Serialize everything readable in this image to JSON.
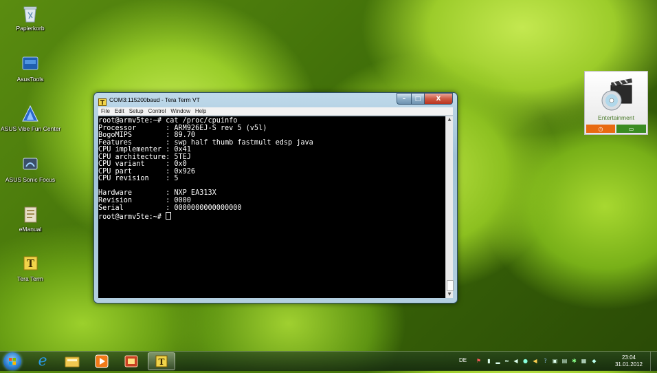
{
  "desktop": {
    "icons": [
      {
        "label": "Papierkorb",
        "icon": "recycle-bin-icon"
      },
      {
        "label": "AsusTools",
        "icon": "asus-tools-icon"
      },
      {
        "label": "ASUS Vibe Fun Center",
        "icon": "asus-vibe-icon"
      },
      {
        "label": "ASUS Sonic Focus",
        "icon": "asus-sonic-focus-icon"
      },
      {
        "label": "eManual",
        "icon": "emanual-icon"
      },
      {
        "label": "Tera Term",
        "icon": "tera-term-icon"
      }
    ]
  },
  "window": {
    "title": "COM3:115200baud - Tera Term VT",
    "minimize_glyph": "–",
    "maximize_glyph": "□",
    "close_glyph": "X",
    "menu": [
      "File",
      "Edit",
      "Setup",
      "Control",
      "Window",
      "Help"
    ]
  },
  "terminal": {
    "lines": [
      "root@armv5te:~# cat /proc/cpuinfo",
      "Processor       : ARM926EJ-S rev 5 (v5l)",
      "BogoMIPS        : 89.70",
      "Features        : swp half thumb fastmult edsp java",
      "CPU implementer : 0x41",
      "CPU architecture: 5TEJ",
      "CPU variant     : 0x0",
      "CPU part        : 0x926",
      "CPU revision    : 5",
      "",
      "Hardware        : NXP EA313X",
      "Revision        : 0000",
      "Serial          : 0000000000000000"
    ],
    "prompt": "root@armv5te:~# "
  },
  "gadget": {
    "label": "Entertainment",
    "left_button_icon": "clock-icon",
    "right_button_icon": "screen-icon",
    "left_color": "#e86a12",
    "right_color": "#3a8c22"
  },
  "taskbar": {
    "pinned": [
      "internet-explorer-icon",
      "file-explorer-icon",
      "media-player-icon",
      "settings-app-icon",
      "tera-term-icon"
    ],
    "language": "DE",
    "clock_time": "23:04",
    "clock_date": "31.01.2012"
  }
}
